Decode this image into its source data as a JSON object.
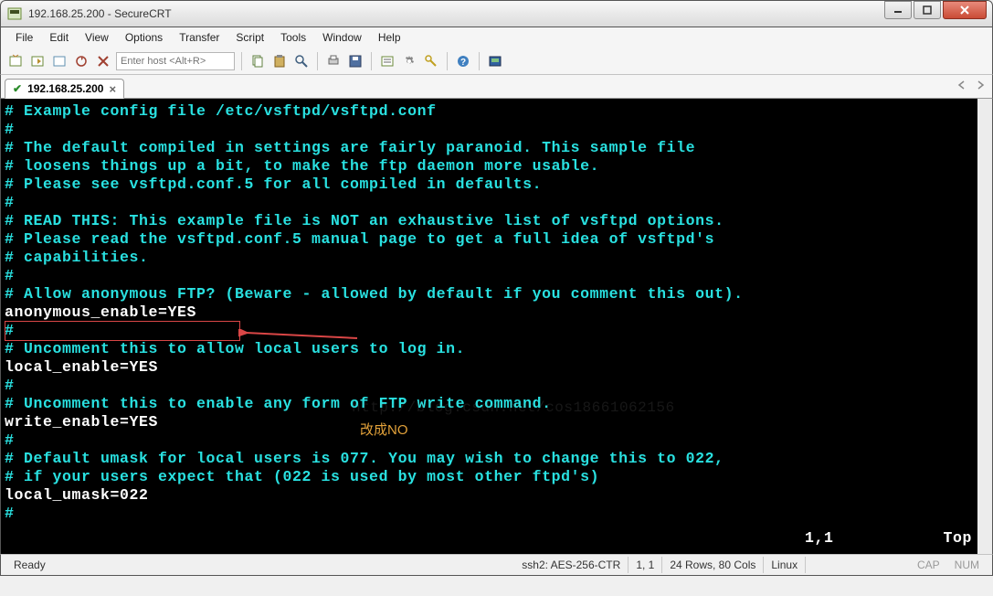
{
  "window": {
    "title": "192.168.25.200 - SecureCRT"
  },
  "menu": {
    "items": [
      "File",
      "Edit",
      "View",
      "Options",
      "Transfer",
      "Script",
      "Tools",
      "Window",
      "Help"
    ]
  },
  "toolbar": {
    "host_placeholder": "Enter host <Alt+R>"
  },
  "tabs": {
    "items": [
      {
        "label": "192.168.25.200"
      }
    ]
  },
  "terminal": {
    "lines": [
      {
        "t": "comment",
        "text": "# Example config file /etc/vsftpd/vsftpd.conf"
      },
      {
        "t": "comment",
        "text": "#"
      },
      {
        "t": "comment",
        "text": "# The default compiled in settings are fairly paranoid. This sample file"
      },
      {
        "t": "comment",
        "text": "# loosens things up a bit, to make the ftp daemon more usable."
      },
      {
        "t": "comment",
        "text": "# Please see vsftpd.conf.5 for all compiled in defaults."
      },
      {
        "t": "comment",
        "text": "#"
      },
      {
        "t": "comment",
        "text": "# READ THIS: This example file is NOT an exhaustive list of vsftpd options."
      },
      {
        "t": "comment",
        "text": "# Please read the vsftpd.conf.5 manual page to get a full idea of vsftpd's"
      },
      {
        "t": "comment",
        "text": "# capabilities."
      },
      {
        "t": "comment",
        "text": "#"
      },
      {
        "t": "comment",
        "text": "# Allow anonymous FTP? (Beware - allowed by default if you comment this out)."
      },
      {
        "t": "value",
        "text": "anonymous_enable=YES"
      },
      {
        "t": "comment",
        "text": "#"
      },
      {
        "t": "comment",
        "text": "# Uncomment this to allow local users to log in."
      },
      {
        "t": "value",
        "text": "local_enable=YES"
      },
      {
        "t": "comment",
        "text": "#"
      },
      {
        "t": "comment",
        "text": "# Uncomment this to enable any form of FTP write command."
      },
      {
        "t": "value",
        "text": "write_enable=YES"
      },
      {
        "t": "comment",
        "text": "#"
      },
      {
        "t": "comment",
        "text": "# Default umask for local users is 077. You may wish to change this to 022,"
      },
      {
        "t": "comment",
        "text": "# if your users expect that (022 is used by most other ftpd's)"
      },
      {
        "t": "value",
        "text": "local_umask=022"
      },
      {
        "t": "comment",
        "text": "#"
      }
    ],
    "cursor_pos": "1,1",
    "scroll_pos": "Top",
    "annotation_text": "改成NO",
    "watermark": "http://blog.csdn.net/cos18661062156"
  },
  "statusbar": {
    "ready": "Ready",
    "cipher": "ssh2: AES-256-CTR",
    "pos": "1,   1",
    "size": "24 Rows, 80 Cols",
    "mode": "Linux",
    "cap": "CAP",
    "num": "NUM"
  }
}
